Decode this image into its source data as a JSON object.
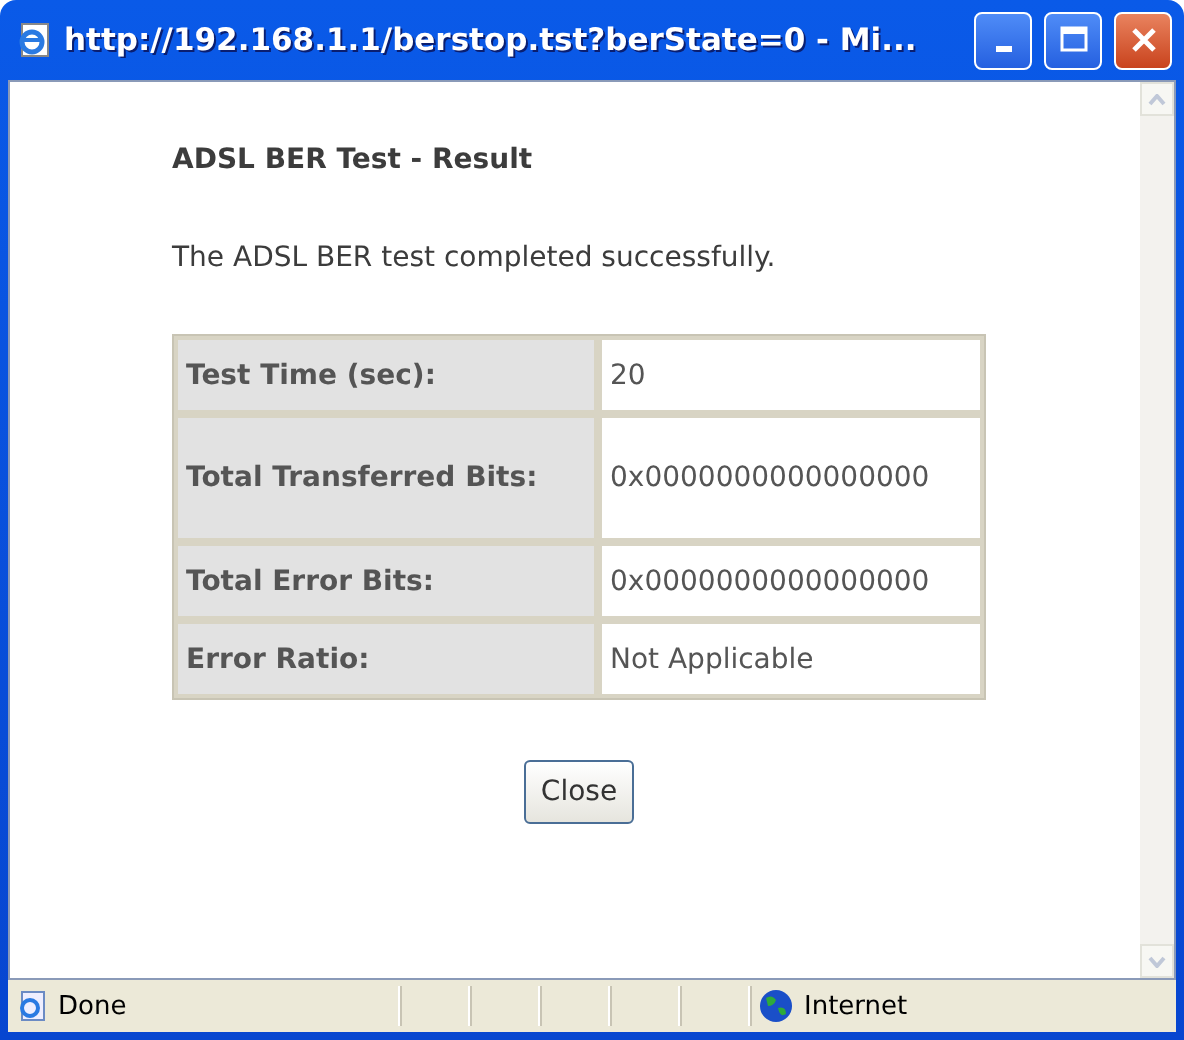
{
  "window": {
    "title": "http://192.168.1.1/berstop.tst?berState=0 - Mi..."
  },
  "heading": "ADSL BER Test - Result",
  "message": "The ADSL BER test completed successfully.",
  "table": {
    "rows": [
      {
        "label": "Test Time (sec):",
        "value": "20"
      },
      {
        "label": "Total Transferred Bits:",
        "value": "0x0000000000000000"
      },
      {
        "label": "Total Error Bits:",
        "value": "0x0000000000000000"
      },
      {
        "label": "Error Ratio:",
        "value": "Not Applicable"
      }
    ]
  },
  "buttons": [
    "Close"
  ],
  "status_bar": {
    "status": "Done",
    "zone": "Internet"
  }
}
